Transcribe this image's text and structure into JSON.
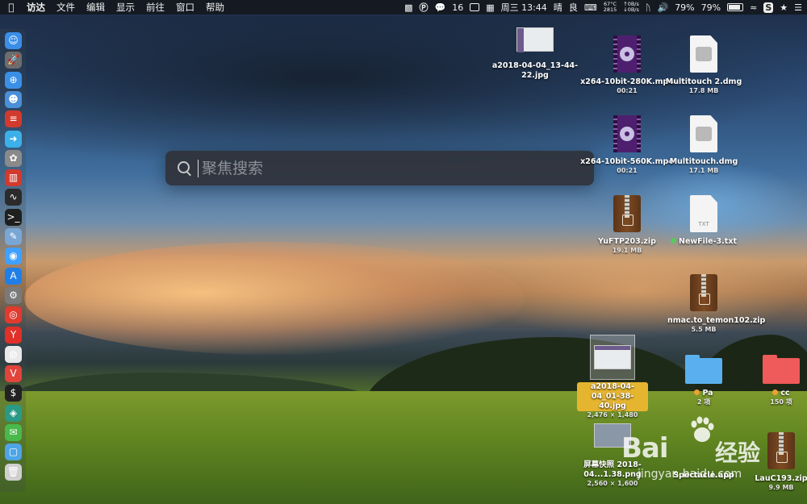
{
  "menubar": {
    "app_name": "访达",
    "menus": [
      "文件",
      "编辑",
      "显示",
      "前往",
      "窗口",
      "帮助"
    ],
    "status": {
      "wechat_badge": "16",
      "datetime": "周三 13:44",
      "weather": "晴",
      "air_quality": "良",
      "cpu_temp": "67°C",
      "fan_rpm": "2815",
      "net_up": "0B/s",
      "net_down": "0B/s",
      "battery_1": "79%",
      "battery_2": "79%"
    }
  },
  "spotlight": {
    "placeholder": "聚焦搜索"
  },
  "desktop": {
    "items": {
      "screenshot1": {
        "name": "a2018-04-04_13-44-22.jpg"
      },
      "video1": {
        "name": "x264-10bit-280K.mp4",
        "meta": "00:21"
      },
      "dmg1": {
        "name": "Multitouch 2.dmg",
        "meta": "17.8 MB"
      },
      "video2": {
        "name": "x264-10bit-560K.mp4",
        "meta": "00:21"
      },
      "dmg2": {
        "name": "Multitouch.dmg",
        "meta": "17.1 MB"
      },
      "zip1": {
        "name": "YuFTP203.zip",
        "meta": "19.1 MB"
      },
      "txt1": {
        "name": "NewFile-3.txt",
        "tag_color": "#5ac85a",
        "icon_label": "TXT"
      },
      "zip2": {
        "name": "nmac.to_temon102.zip",
        "meta": "5.5 MB"
      },
      "screenshot2": {
        "name": "a2018-04-04_01-38-40.jpg",
        "meta": "2,476 × 1,480"
      },
      "folder_pa": {
        "name": "Pa",
        "meta": "2 項",
        "tag_color": "#f0a030",
        "folder_color": "#5ab0ee"
      },
      "folder_cc": {
        "name": "cc",
        "meta": "150 项",
        "tag_color": "#f0a030",
        "folder_color": "#ef5a5a"
      },
      "screenshot3": {
        "name": "屏幕快照 2018-04...1.38.png",
        "meta": "2,560 × 1,600"
      },
      "app1": {
        "name": "Spectacle.app"
      },
      "zip3": {
        "name": "LauC193.zip",
        "meta": "9.9 MB"
      }
    }
  },
  "watermark": {
    "brand": "Bai",
    "brand_cn": "经验",
    "url": "jingyan.baidu.com"
  },
  "dock": {
    "icons": [
      "finder-icon",
      "launchpad-icon",
      "safari-icon",
      "contacts-icon",
      "netease-music-icon",
      "migration-icon",
      "photo-icon",
      "istat-icon",
      "activity-monitor-icon",
      "terminal-icon",
      "preview-icon",
      "siri-icon",
      "app-store-icon",
      "system-preferences-icon",
      "netease-cloud-icon",
      "yandex-icon",
      "chrome-icon",
      "vivaldi-icon",
      "iterm-icon",
      "anydesk-icon",
      "wechat-icon",
      "downloads-folder-icon",
      "trash-icon"
    ],
    "colors": [
      "#3b8ee8",
      "#6d6d6d",
      "#3a8fe6",
      "#4a8fd8",
      "#d23a2e",
      "#3cb0e8",
      "#8a8a8a",
      "#d23a2e",
      "#2b2b2b",
      "#1f1f1f",
      "#7aa6d4",
      "#3fa0ff",
      "#1f7fe6",
      "#7a7a7a",
      "#e23a2f",
      "#e03028",
      "#e9e9e9",
      "#e0443a",
      "#222222",
      "#2a9a84",
      "#48b94a",
      "#4da5e6",
      "#cfcfcf"
    ]
  }
}
